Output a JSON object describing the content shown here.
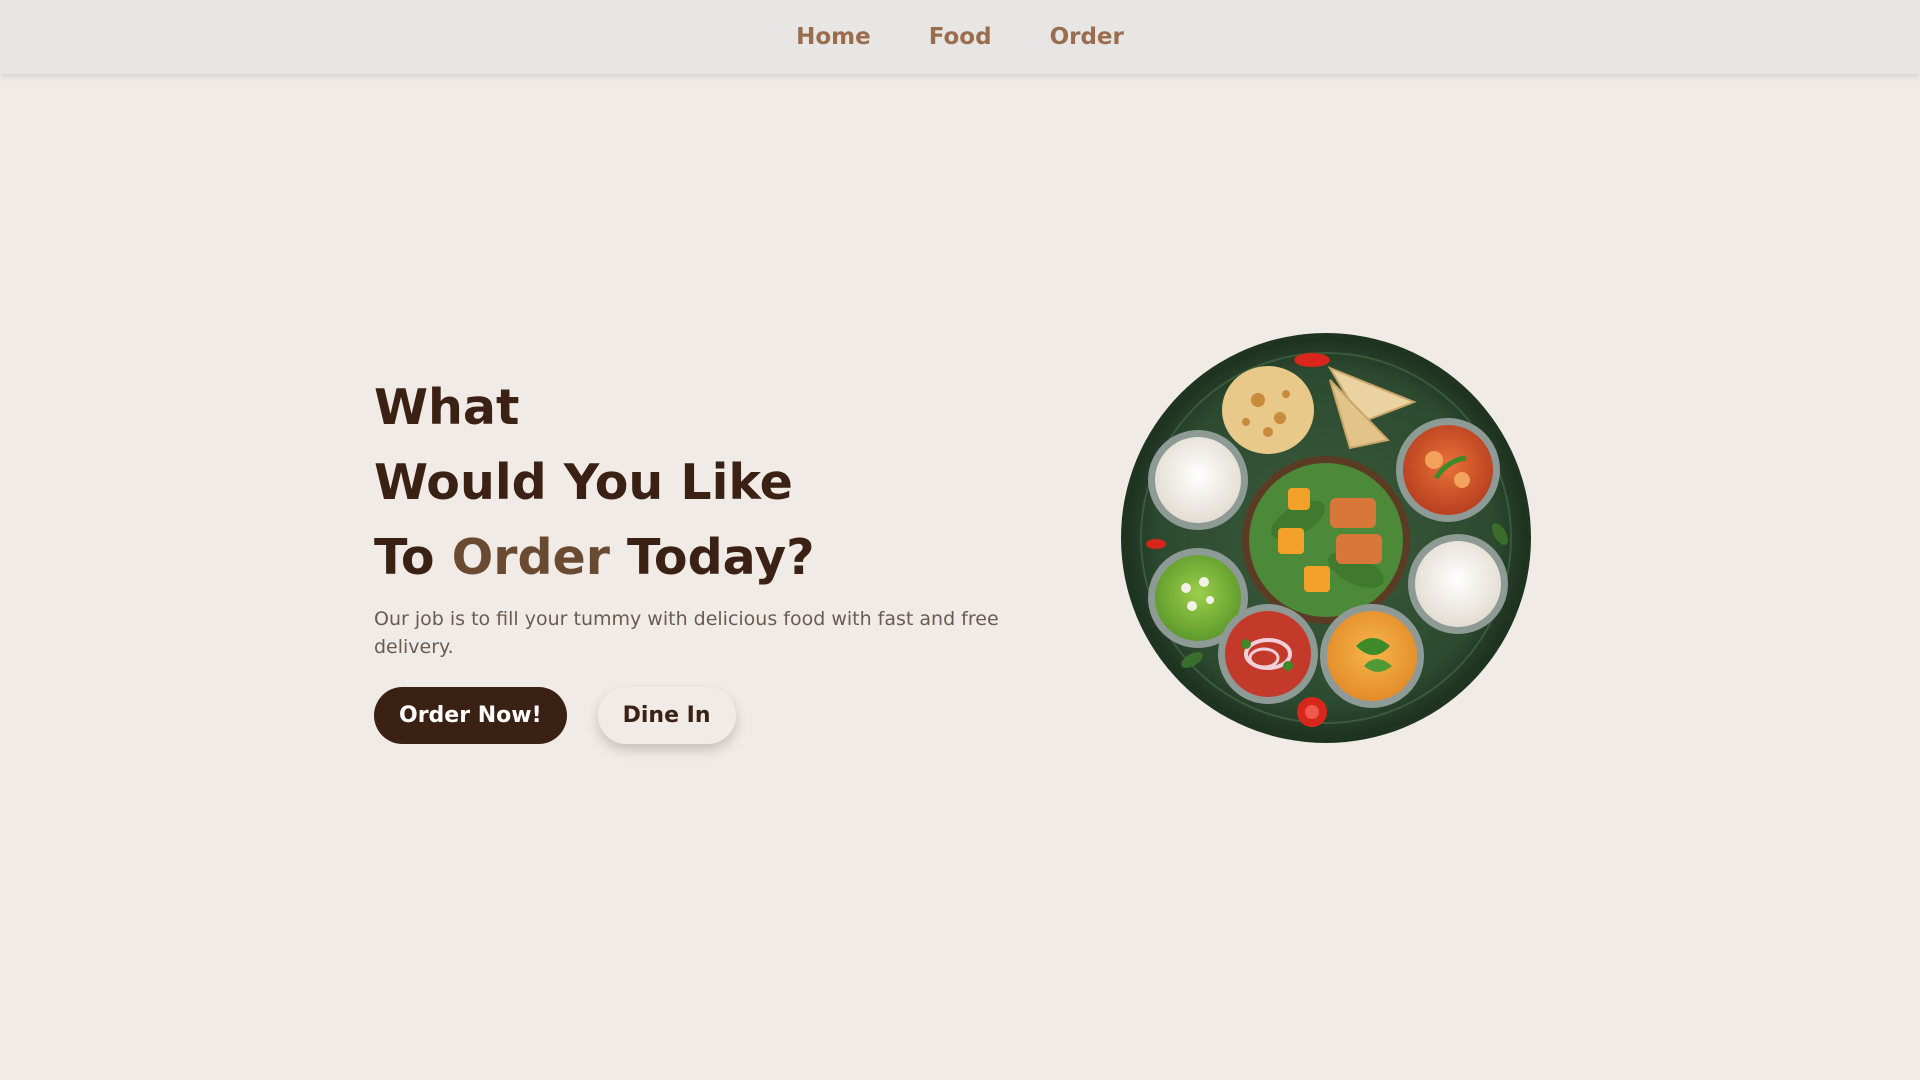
{
  "nav": {
    "links": [
      "Home",
      "Food",
      "Order"
    ]
  },
  "hero": {
    "line1": "What",
    "line2": "Would You Like",
    "line3_prefix": "To ",
    "line3_accent": "Order",
    "line3_suffix": " Today?",
    "tagline": "Our job is to fill your tummy with delicious food with fast and free delivery.",
    "primary_button": "Order Now!",
    "secondary_button": "Dine In"
  },
  "colors": {
    "background": "#f0ebe6",
    "navbar": "#e8e6e4",
    "nav_link": "#9a6d4e",
    "heading": "#3a2113",
    "accent": "#6b4a32",
    "primary_button": "#3a2113"
  },
  "image": {
    "name": "food-plate-thali-icon"
  }
}
